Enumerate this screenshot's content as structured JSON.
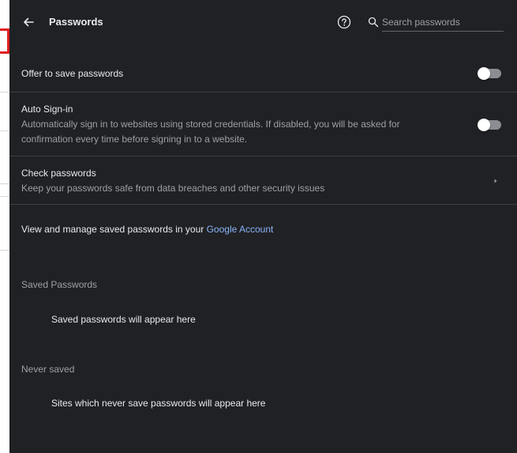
{
  "header": {
    "title": "Passwords",
    "back_icon": "arrow-left-icon",
    "help_icon": "help-circle-icon",
    "search": {
      "icon": "search-icon",
      "placeholder": "Search passwords",
      "value": ""
    }
  },
  "settings": {
    "offer_to_save": {
      "label": "Offer to save passwords",
      "enabled": false
    },
    "auto_sign_in": {
      "label": "Auto Sign-in",
      "description_line1": "Automatically sign in to websites using stored credentials. If disabled, you will be asked for",
      "description_line2": "confirmation every time before signing in to a website.",
      "enabled": false
    },
    "check_passwords": {
      "label": "Check passwords",
      "description": "Keep your passwords safe from data breaches and other security issues"
    },
    "manage": {
      "text": "View and manage saved passwords in your ",
      "link": "Google Account"
    }
  },
  "saved_passwords": {
    "title": "Saved Passwords",
    "empty_message": "Saved passwords will appear here"
  },
  "never_saved": {
    "title": "Never saved",
    "empty_message": "Sites which never save passwords will appear here"
  },
  "colors": {
    "panel_background": "#202124",
    "text_primary": "#e8eaed",
    "text_secondary": "#9aa0a6",
    "link": "#8ab4f8",
    "toggle_off_track": "#8a8d91"
  }
}
